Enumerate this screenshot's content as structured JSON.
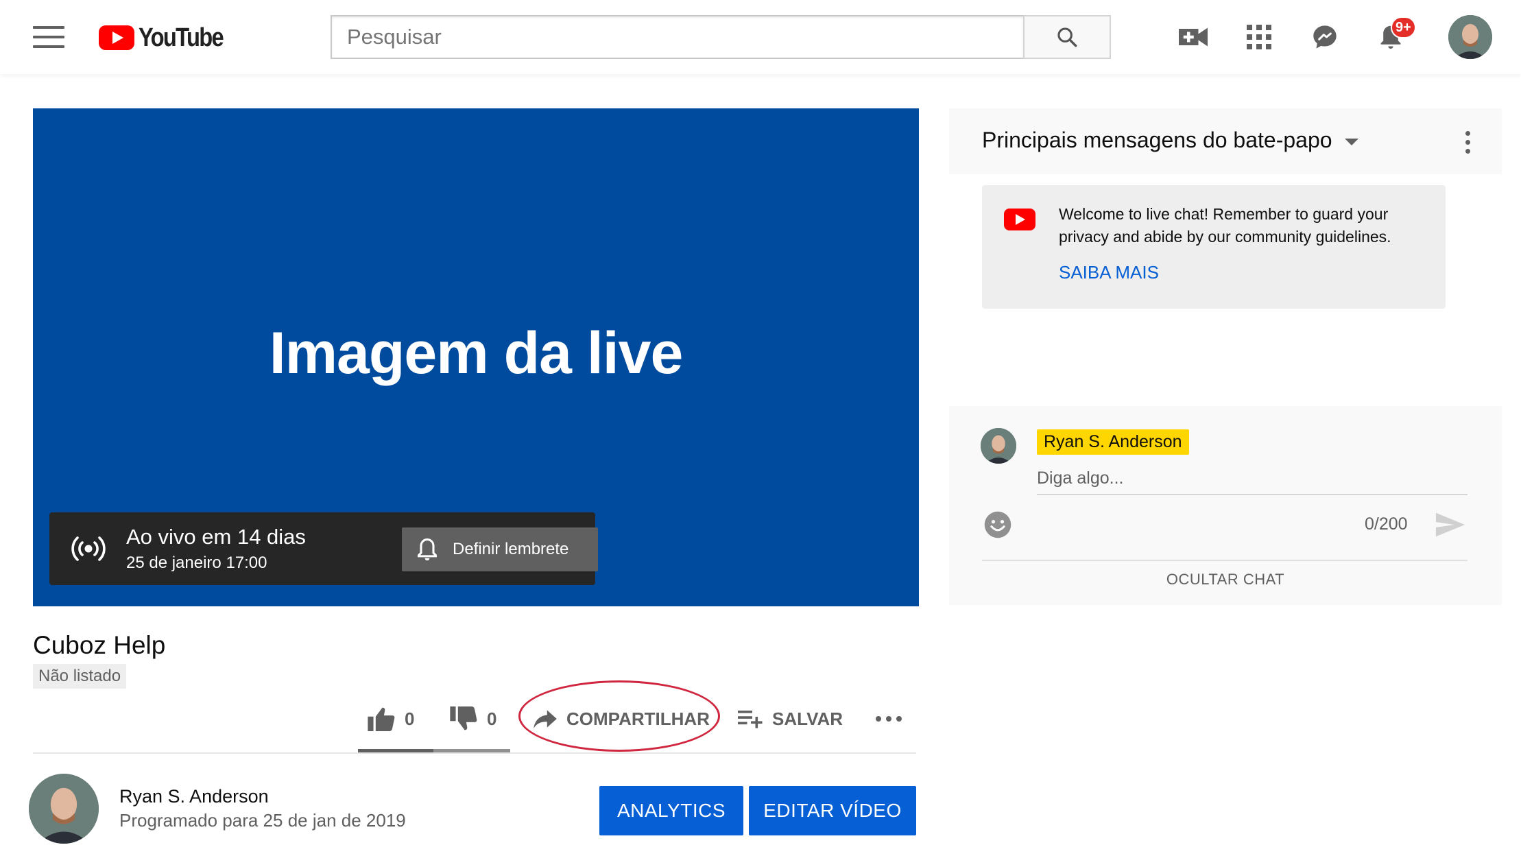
{
  "header": {
    "logo_text": "YouTube",
    "search_placeholder": "Pesquisar",
    "notification_badge": "9+",
    "icons": [
      "menu-icon",
      "video-camera-add-icon",
      "apps-grid-icon",
      "messages-icon",
      "bell-icon",
      "search-icon"
    ]
  },
  "player": {
    "title": "Imagem da live",
    "live_status": "Ao vivo em 14 dias",
    "live_datetime": "25 de janeiro 17:00",
    "reminder_label": "Definir lembrete"
  },
  "video": {
    "channel_title": "Cuboz Help",
    "visibility_badge": "Não listado",
    "likes": "0",
    "dislikes": "0",
    "share_label": "COMPARTILHAR",
    "save_label": "SALVAR",
    "owner_name": "Ryan S. Anderson",
    "scheduled_text": "Programado para 25 de jan de 2019",
    "analytics_label": "ANALYTICS",
    "edit_label": "EDITAR VÍDEO"
  },
  "chat": {
    "title": "Principais mensagens do bate-papo",
    "welcome_text": "Welcome to live chat! Remember to guard your privacy and abide by our community guidelines.",
    "learn_more": "SAIBA MAIS",
    "author_name": "Ryan S. Anderson",
    "input_placeholder": "Diga algo...",
    "char_counter": "0/200",
    "hide_label": "OCULTAR CHAT"
  },
  "colors": {
    "player_background": "#004b9e",
    "brand_red": "#ff0000",
    "button_blue": "#065fd4",
    "author_chip": "#ffd600",
    "share_highlight": "#d0263f"
  }
}
